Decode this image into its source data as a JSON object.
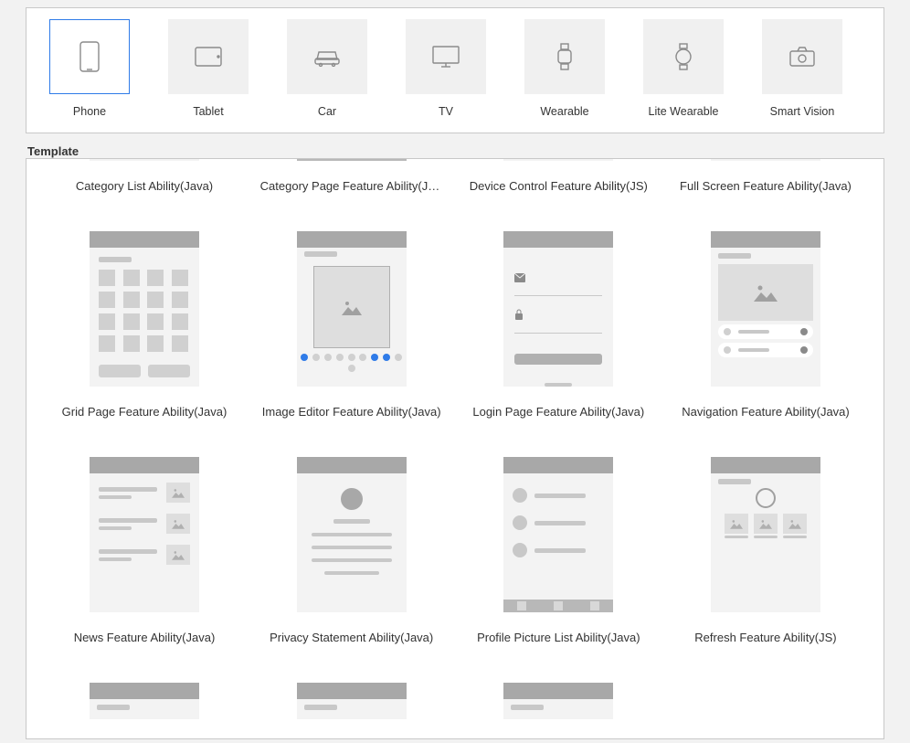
{
  "devices": [
    {
      "id": "phone",
      "label": "Phone",
      "selected": true
    },
    {
      "id": "tablet",
      "label": "Tablet",
      "selected": false
    },
    {
      "id": "car",
      "label": "Car",
      "selected": false
    },
    {
      "id": "tv",
      "label": "TV",
      "selected": false
    },
    {
      "id": "wearable",
      "label": "Wearable",
      "selected": false
    },
    {
      "id": "litewearable",
      "label": "Lite Wearable",
      "selected": false
    },
    {
      "id": "smartvision",
      "label": "Smart Vision",
      "selected": false
    }
  ],
  "section_label": "Template",
  "templates_row0": [
    {
      "title": "Category List Ability(Java)"
    },
    {
      "title": "Category Page Feature Ability(Jav..."
    },
    {
      "title": "Device Control Feature Ability(JS)"
    },
    {
      "title": "Full Screen Feature Ability(Java)"
    }
  ],
  "templates_row1": [
    {
      "title": "Grid Page Feature Ability(Java)"
    },
    {
      "title": "Image Editor Feature Ability(Java)"
    },
    {
      "title": "Login Page Feature Ability(Java)"
    },
    {
      "title": "Navigation Feature Ability(Java)"
    }
  ],
  "templates_row2": [
    {
      "title": "News Feature Ability(Java)"
    },
    {
      "title": "Privacy Statement Ability(Java)"
    },
    {
      "title": "Profile Picture List Ability(Java)"
    },
    {
      "title": "Refresh Feature Ability(JS)"
    }
  ],
  "templates_row3": [
    {
      "title": ""
    },
    {
      "title": ""
    },
    {
      "title": ""
    }
  ]
}
